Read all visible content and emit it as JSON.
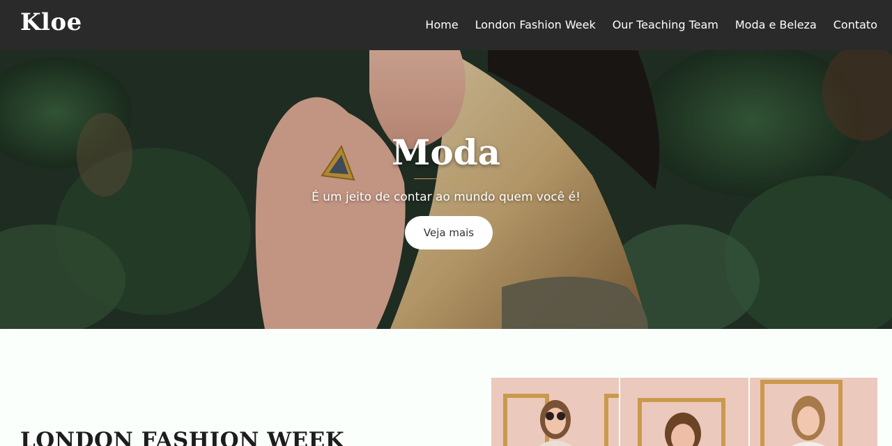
{
  "brand": {
    "name": "Kloe"
  },
  "nav": {
    "items": [
      {
        "label": "Home"
      },
      {
        "label": "London Fashion Week"
      },
      {
        "label": "Our Teaching Team"
      },
      {
        "label": "Moda e Beleza"
      },
      {
        "label": "Contato"
      }
    ]
  },
  "hero": {
    "title": "Moda",
    "subtitle": "É um jeito de contar ao mundo quem você é!",
    "button_label": "Veja mais"
  },
  "section": {
    "title": "LONDON FASHION WEEK"
  },
  "gallery": {
    "images": [
      {
        "icon": "fashion-model-photo"
      },
      {
        "icon": "fashion-model-photo"
      },
      {
        "icon": "fashion-model-photo"
      }
    ]
  },
  "colors": {
    "navbar": "#2a2a2a",
    "accent": "#c79a54",
    "page_bg": "#fbfffc"
  }
}
